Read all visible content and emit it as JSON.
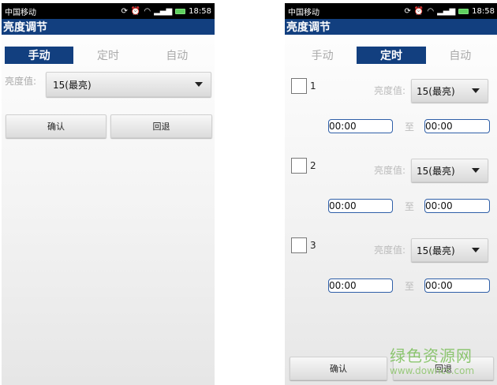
{
  "status_bar": {
    "carrier": "中国移动",
    "time": "18:58"
  },
  "app": {
    "title": "亮度调节"
  },
  "tabs": [
    "手动",
    "定时",
    "自动"
  ],
  "manual": {
    "brightness_label": "亮度值:",
    "brightness_value": "15(最亮)",
    "confirm_label": "确认",
    "back_label": "回退"
  },
  "timer": {
    "slots": [
      {
        "number": "1",
        "brightness_label": "亮度值:",
        "brightness_value": "15(最亮)",
        "start": "00:00",
        "to_label": "至",
        "end": "00:00"
      },
      {
        "number": "2",
        "brightness_label": "亮度值:",
        "brightness_value": "15(最亮)",
        "start": "00:00",
        "to_label": "至",
        "end": "00:00"
      },
      {
        "number": "3",
        "brightness_label": "亮度值:",
        "brightness_value": "15(最亮)",
        "start": "00:00",
        "to_label": "至",
        "end": "00:00"
      }
    ],
    "confirm_label": "确认",
    "back_label": "回退"
  },
  "watermark": {
    "text": "绿色资源网",
    "url": "www.downcc.com"
  },
  "colors": {
    "title_bar": "#123f7f",
    "active_tab": "#123f7f",
    "time_border": "#2f5fa8"
  }
}
